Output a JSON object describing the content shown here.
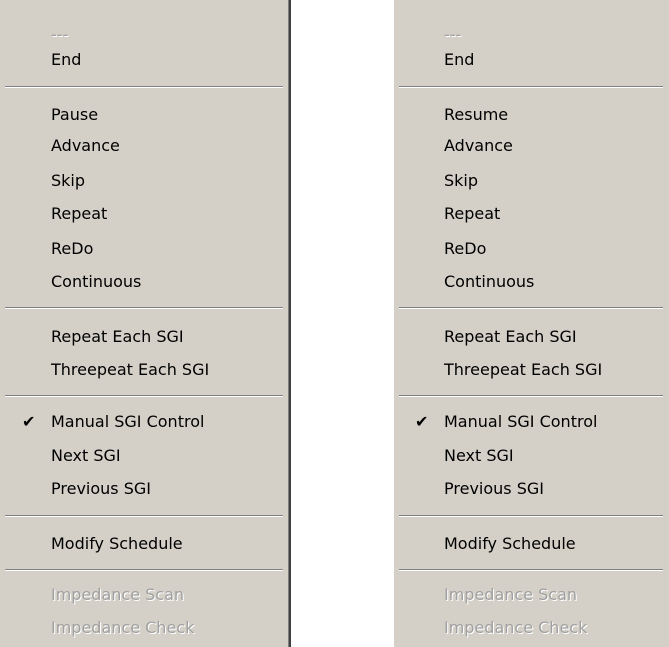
{
  "left_menu": {
    "items": [
      {
        "label": "---",
        "disabled": true
      },
      {
        "label": "End"
      },
      {
        "label": "Pause"
      },
      {
        "label": "Advance"
      },
      {
        "label": "Skip"
      },
      {
        "label": "Repeat"
      },
      {
        "label": "ReDo"
      },
      {
        "label": "Continuous"
      },
      {
        "label": "Repeat Each SGI"
      },
      {
        "label": "Threepeat Each SGI"
      },
      {
        "label": "Manual SGI Control",
        "checked": true
      },
      {
        "label": "Next SGI"
      },
      {
        "label": "Previous SGI"
      },
      {
        "label": "Modify Schedule"
      },
      {
        "label": "Impedance Scan",
        "disabled": true
      },
      {
        "label": "Impedance Check",
        "disabled": true
      }
    ]
  },
  "right_menu": {
    "items": [
      {
        "label": "---",
        "disabled": true
      },
      {
        "label": "End"
      },
      {
        "label": "Resume"
      },
      {
        "label": "Advance"
      },
      {
        "label": "Skip"
      },
      {
        "label": "Repeat"
      },
      {
        "label": "ReDo"
      },
      {
        "label": "Continuous"
      },
      {
        "label": "Repeat Each SGI"
      },
      {
        "label": "Threepeat Each SGI"
      },
      {
        "label": "Manual SGI Control",
        "checked": true
      },
      {
        "label": "Next SGI"
      },
      {
        "label": "Previous SGI"
      },
      {
        "label": "Modify Schedule"
      },
      {
        "label": "Impedance Scan",
        "disabled": true
      },
      {
        "label": "Impedance Check",
        "disabled": true
      }
    ]
  },
  "check_glyph": "✔",
  "colors": {
    "menu_bg": "#d4d0c8",
    "text": "#000000",
    "disabled_text": "#a0a0a0",
    "separator_dark": "#808080",
    "separator_light": "#ffffff"
  }
}
